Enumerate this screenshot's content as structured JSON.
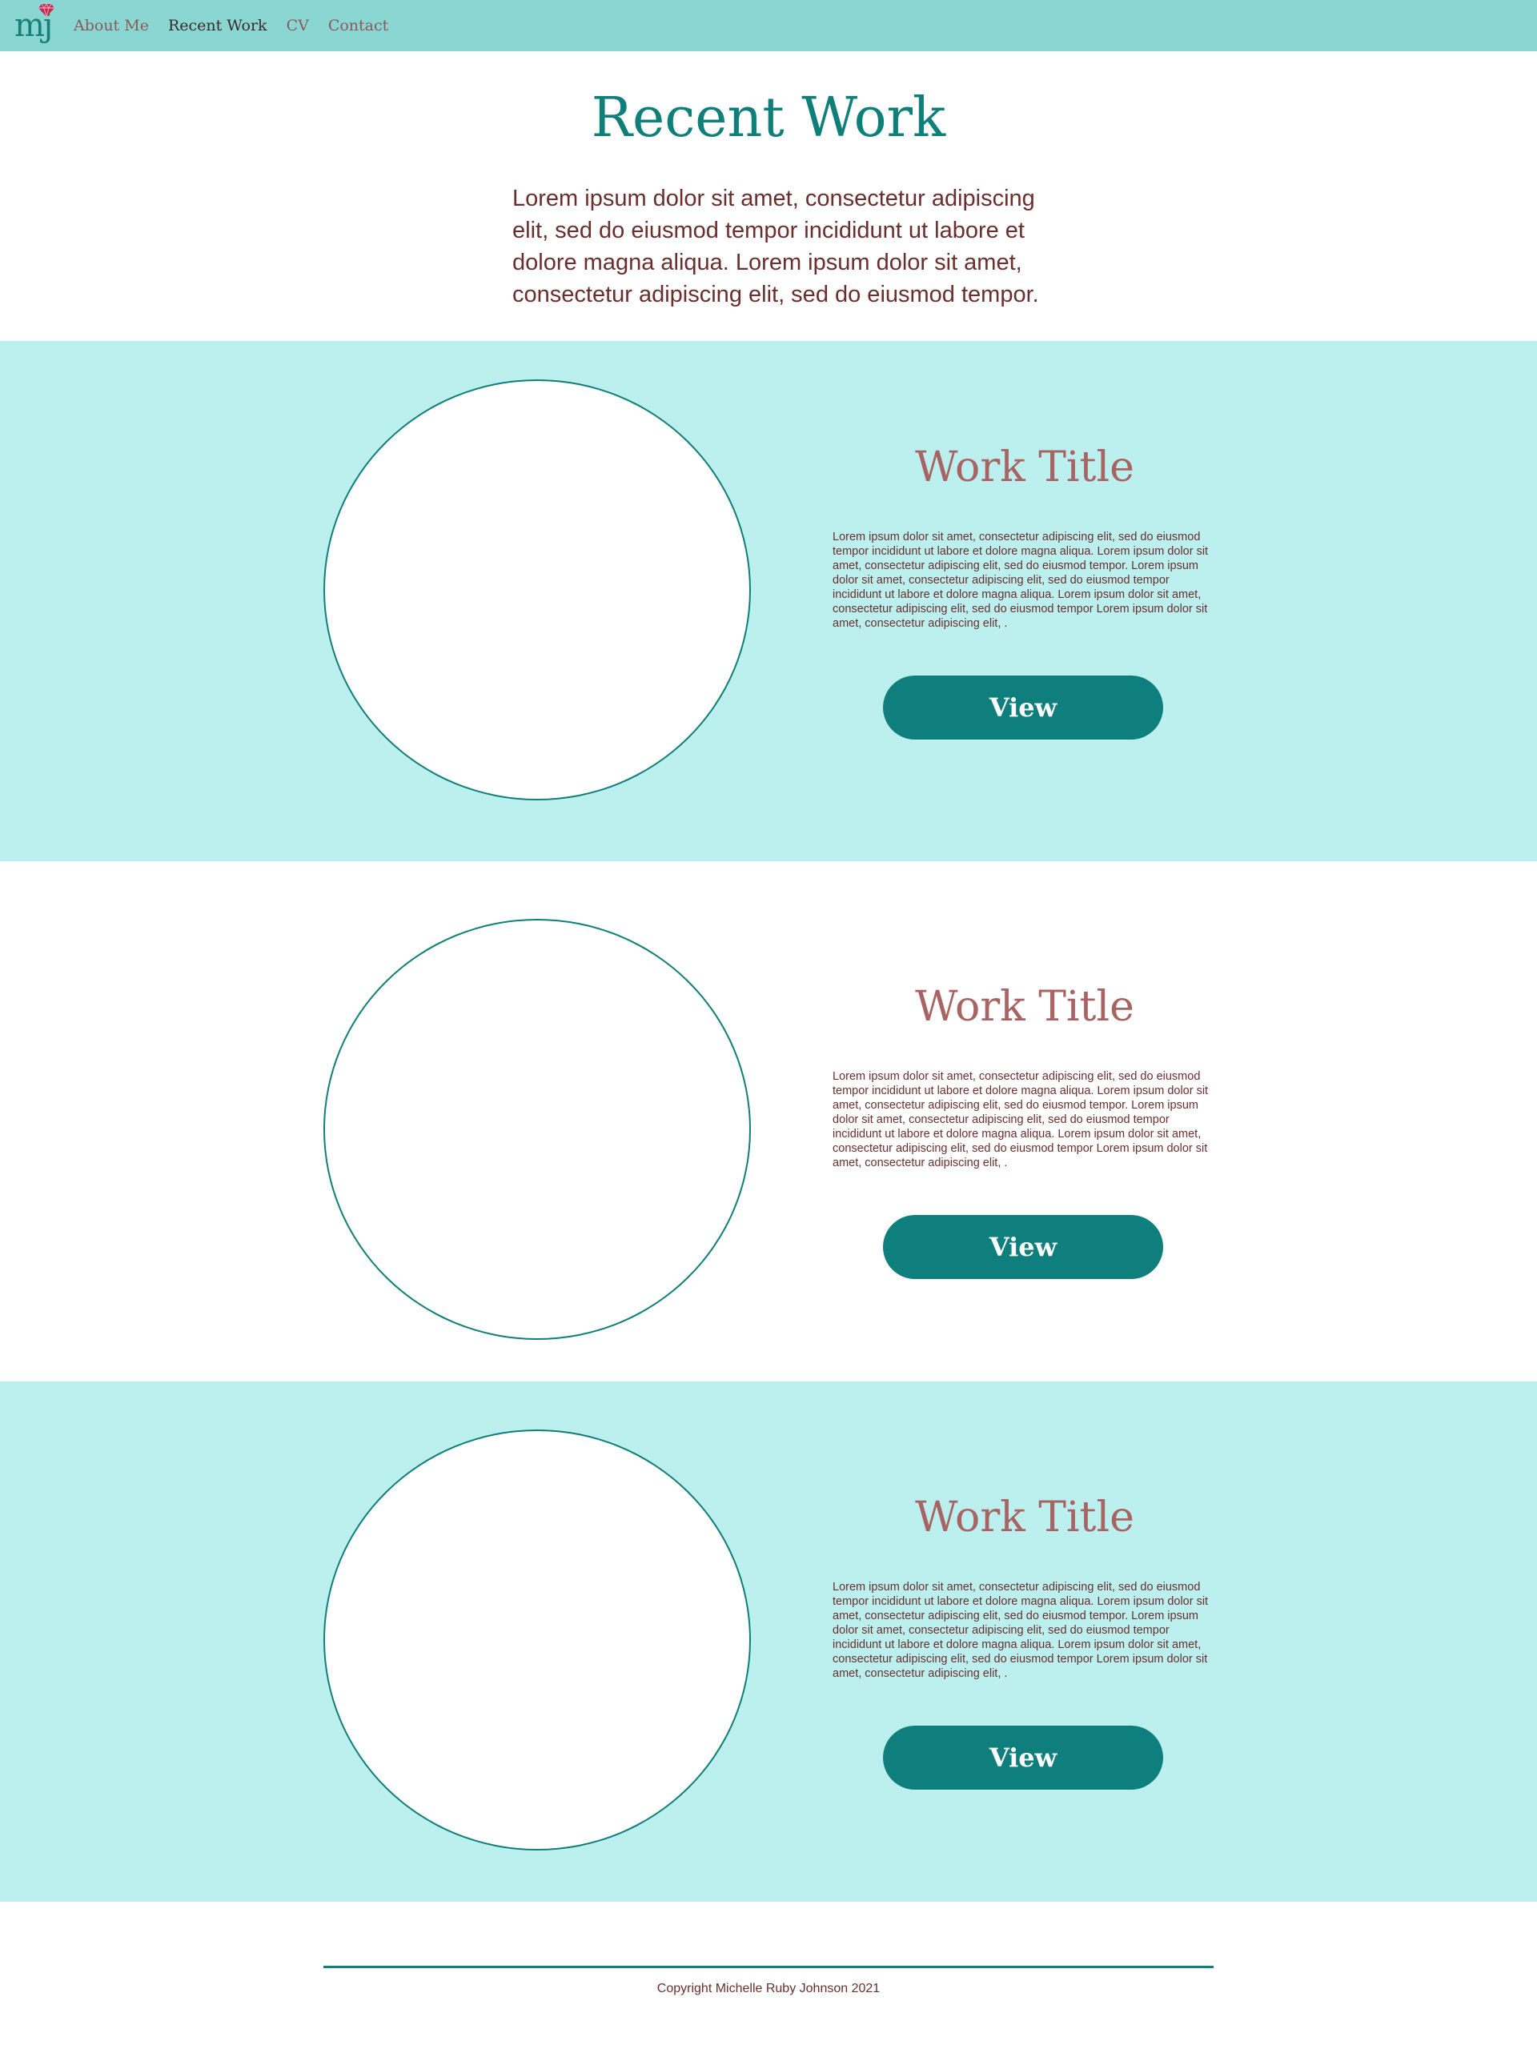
{
  "nav": {
    "logo_text": "mj",
    "links": [
      "About Me",
      "Recent Work",
      "CV",
      "Contact"
    ],
    "active": "Recent Work"
  },
  "header": {
    "title": "Recent Work",
    "intro": "Lorem ipsum dolor sit amet, consectetur adipiscing elit, sed do eiusmod tempor incididunt ut labore et dolore magna aliqua. Lorem ipsum dolor sit amet, consectetur adipiscing elit, sed do eiusmod tempor."
  },
  "works": [
    {
      "title": "Work Title",
      "description": "Lorem ipsum dolor sit amet, consectetur adipiscing elit, sed do eiusmod tempor incididunt ut labore et dolore magna aliqua. Lorem ipsum dolor sit amet, consectetur adipiscing elit, sed do eiusmod tempor.   Lorem ipsum dolor sit amet, consectetur adipiscing elit, sed do eiusmod tempor incididunt ut labore et dolore magna aliqua. Lorem ipsum dolor sit amet, consectetur adipiscing elit, sed do eiusmod tempor Lorem ipsum dolor sit amet, consectetur adipiscing elit, .",
      "button": "View"
    },
    {
      "title": "Work Title",
      "description": "Lorem ipsum dolor sit amet, consectetur adipiscing elit, sed do eiusmod tempor incididunt ut labore et dolore magna aliqua. Lorem ipsum dolor sit amet, consectetur adipiscing elit, sed do eiusmod tempor.   Lorem ipsum dolor sit amet, consectetur adipiscing elit, sed do eiusmod tempor incididunt ut labore et dolore magna aliqua. Lorem ipsum dolor sit amet, consectetur adipiscing elit, sed do eiusmod tempor Lorem ipsum dolor sit amet, consectetur adipiscing elit, .",
      "button": "View"
    },
    {
      "title": "Work Title",
      "description": "Lorem ipsum dolor sit amet, consectetur adipiscing elit, sed do eiusmod tempor incididunt ut labore et dolore magna aliqua. Lorem ipsum dolor sit amet, consectetur adipiscing elit, sed do eiusmod tempor.   Lorem ipsum dolor sit amet, consectetur adipiscing elit, sed do eiusmod tempor incididunt ut labore et dolore magna aliqua. Lorem ipsum dolor sit amet, consectetur adipiscing elit, sed do eiusmod tempor Lorem ipsum dolor sit amet, consectetur adipiscing elit, .",
      "button": "View"
    }
  ],
  "footer": {
    "copyright": "Copyright Michelle Ruby Johnson 2021"
  },
  "colors": {
    "nav_bg": "#8ad6d2",
    "section_tint": "#bbf0ef",
    "teal": "#0f7f7a",
    "rose": "#a86363",
    "text_brown": "#6b2e2e",
    "gem": "#c4284f"
  }
}
